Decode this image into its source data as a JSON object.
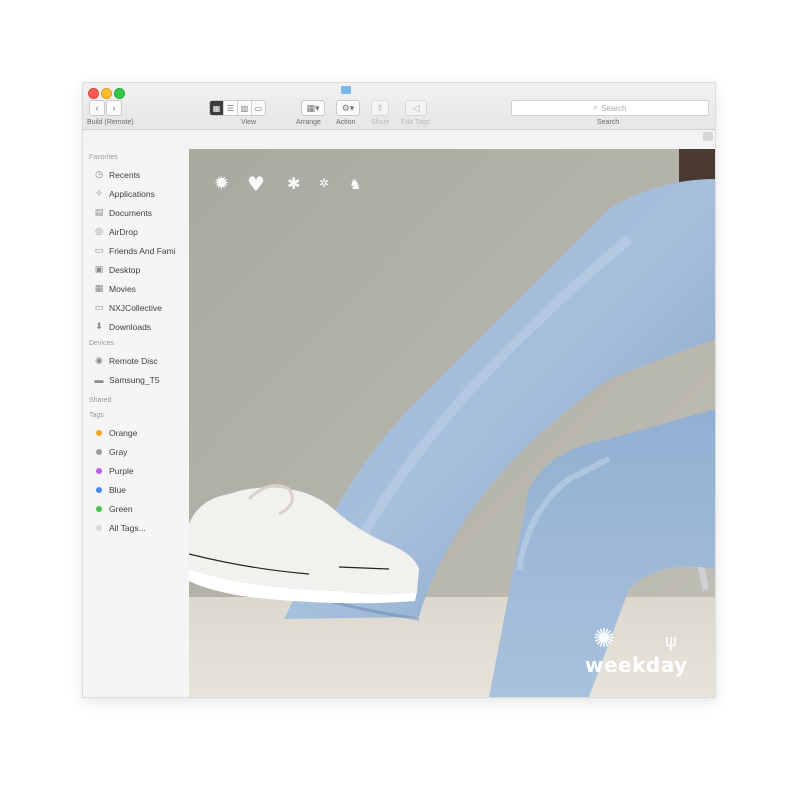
{
  "window": {
    "path_label": "Build (Remote)",
    "toolbar": {
      "view_label": "View",
      "arrange_label": "Arrange",
      "action_label": "Action",
      "share_label": "Share",
      "edit_tags_label": "Edit Tags",
      "search_placeholder": "Search",
      "search_label": "Search"
    }
  },
  "sidebar": {
    "favorites_header": "Favorites",
    "favorites": [
      {
        "label": "Recents",
        "icon": "clock-icon"
      },
      {
        "label": "Applications",
        "icon": "applications-icon"
      },
      {
        "label": "Documents",
        "icon": "documents-icon"
      },
      {
        "label": "AirDrop",
        "icon": "airdrop-icon"
      },
      {
        "label": "Friends And Fami",
        "icon": "folder-icon"
      },
      {
        "label": "Desktop",
        "icon": "desktop-icon"
      },
      {
        "label": "Movies",
        "icon": "movies-icon"
      },
      {
        "label": "NXJCollective",
        "icon": "folder-icon"
      },
      {
        "label": "Downloads",
        "icon": "downloads-icon"
      }
    ],
    "devices_header": "Devices",
    "devices": [
      {
        "label": "Remote Disc",
        "icon": "disc-icon"
      },
      {
        "label": "Samsung_T5",
        "icon": "drive-icon"
      }
    ],
    "shared_header": "Shared",
    "tags_header": "Tags",
    "tags": [
      {
        "label": "Orange",
        "color": "#f5a623"
      },
      {
        "label": "Gray",
        "color": "#9b9b9b"
      },
      {
        "label": "Purple",
        "color": "#bd5ce0"
      },
      {
        "label": "Blue",
        "color": "#3d8ef0"
      },
      {
        "label": "Green",
        "color": "#45c04a"
      },
      {
        "label": "All Tags...",
        "color": "#d8d8d8"
      }
    ]
  },
  "content": {
    "brand_text": "weekday"
  }
}
